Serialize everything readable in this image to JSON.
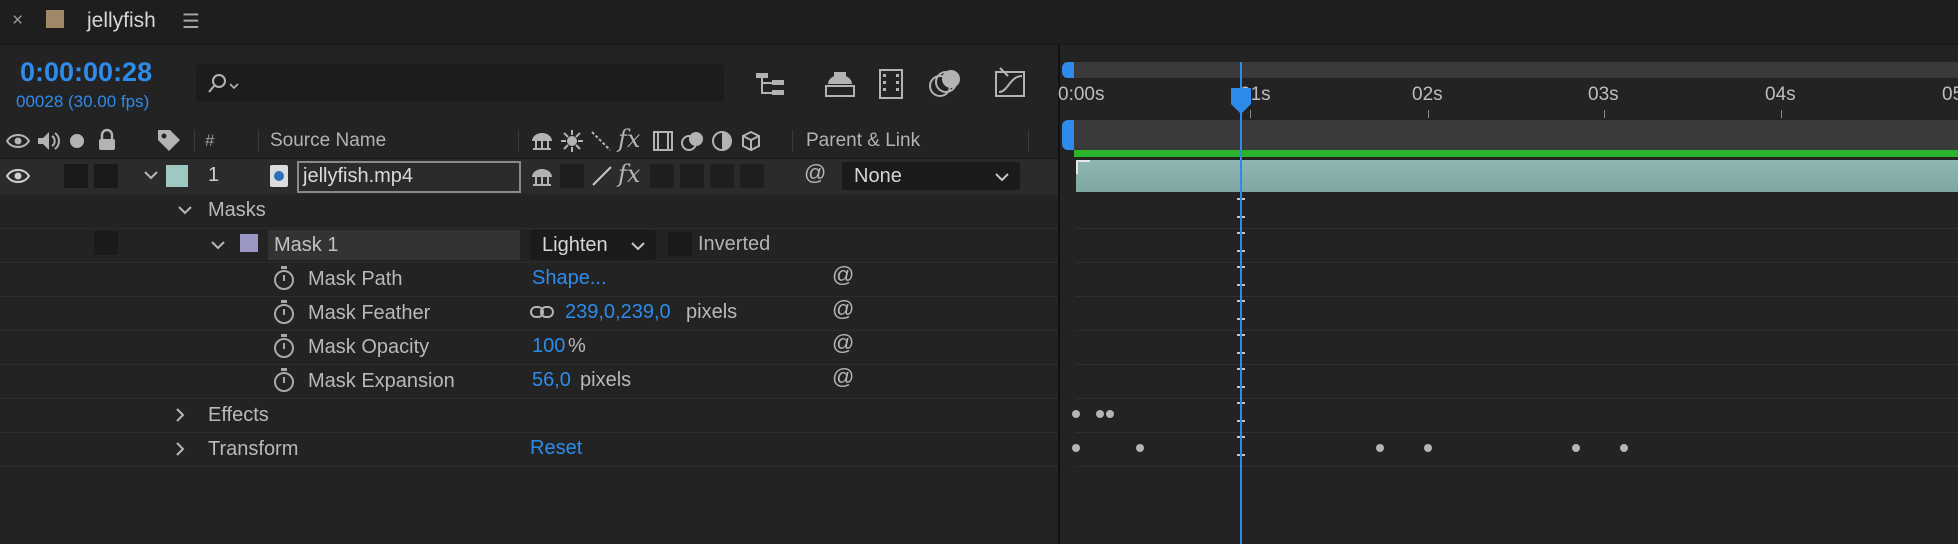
{
  "tab": {
    "close": "×",
    "title": "jellyfish",
    "menu": "☰",
    "swatch_color": "#a08868"
  },
  "time": {
    "timecode": "0:00:00:28",
    "frames": "00028 (30.00 fps)"
  },
  "search": {
    "placeholder": ""
  },
  "columns": {
    "hash": "#",
    "source_name": "Source Name",
    "parent_link": "Parent & Link",
    "fx": "fx"
  },
  "layer": {
    "number": "1",
    "name": "jellyfish.mp4",
    "parent": "None",
    "label_color": "#9ec9c3",
    "fx": "fx"
  },
  "masks": {
    "group_label": "Masks",
    "mask1": {
      "name": "Mask 1",
      "mode": "Lighten",
      "inverted_label": "Inverted",
      "color": "#9a97c4"
    },
    "properties": [
      {
        "name": "Mask Path",
        "value": "Shape...",
        "unit": ""
      },
      {
        "name": "Mask Feather",
        "value": "239,0,239,0",
        "unit": "pixels"
      },
      {
        "name": "Mask Opacity",
        "value": "100",
        "unit": "%"
      },
      {
        "name": "Mask Expansion",
        "value": "56,0",
        "unit": "pixels"
      }
    ]
  },
  "effects": {
    "label": "Effects"
  },
  "transform": {
    "label": "Transform",
    "reset": "Reset"
  },
  "timeline": {
    "ruler": [
      "0:00s",
      "01s",
      "02s",
      "03s",
      "04s",
      "05"
    ],
    "playhead_color": "#2d8ceb",
    "work_area_color": "#2bb32b"
  }
}
